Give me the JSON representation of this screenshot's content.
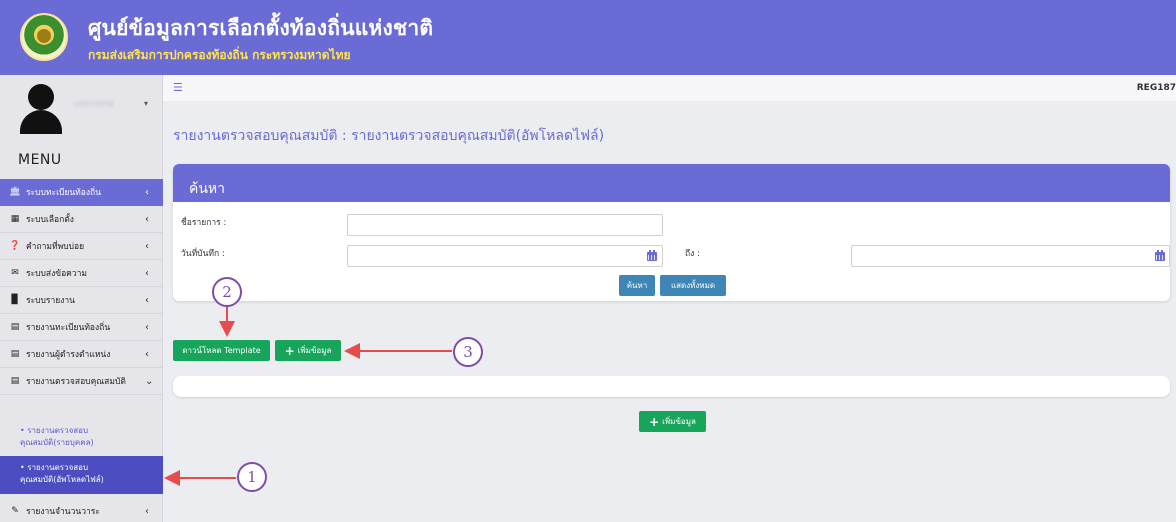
{
  "header": {
    "title": "ศูนย์ข้อมูลการเลือกตั้งท้องถิ่นแห่งชาติ",
    "subtitle": "กรมส่งเสริมการปกครองท้องถิ่น กระทรวงมหาดไทย"
  },
  "sidebar": {
    "user_name": "username",
    "menu_title": "MENU",
    "items": [
      {
        "label": "ระบบทะเบียนท้องถิ่น",
        "icon": "institution-icon"
      },
      {
        "label": "ระบบเลือกตั้ง",
        "icon": "calendar-icon"
      },
      {
        "label": "คำถามที่พบบ่อย",
        "icon": "question-icon"
      },
      {
        "label": "ระบบส่งข้อความ",
        "icon": "envelope-icon"
      },
      {
        "label": "ระบบรายงาน",
        "icon": "file-icon"
      },
      {
        "label": "รายงานทะเบียนท้องถิ่น",
        "icon": "file-text-icon"
      },
      {
        "label": "รายงานผู้ดำรงตำแหน่ง",
        "icon": "file-text-icon"
      },
      {
        "label": "รายงานตรวจสอบคุณสมบัติ",
        "icon": "file-text-icon"
      },
      {
        "label": "รายงานจำนวนวาระ",
        "icon": "edit-icon"
      }
    ],
    "sub_items": [
      {
        "label_line1": "• รายงานตรวจสอบ",
        "label_line2": "คุณสมบัติ(รายบุคคล)"
      },
      {
        "label_line1": "• รายงานตรวจสอบ",
        "label_line2": "คุณสมบัติ(อัพโหลดไฟล์)"
      }
    ]
  },
  "topstrip": {
    "menu_icon": "☰",
    "code": "REG187"
  },
  "page": {
    "title": "รายงานตรวจสอบคุณสมบัติ : รายงานตรวจสอบคุณสมบัติ(อัพโหลดไฟล์)"
  },
  "search": {
    "heading": "ค้นหา",
    "name_label": "ชื่อรายการ :",
    "name_value": "",
    "date_label": "วันที่บันทึก :",
    "date_from_value": "",
    "to_label": "ถึง :",
    "date_to_value": "",
    "search_button": "ค้นหา",
    "show_all_button": "แสดงทั้งหมด"
  },
  "actions": {
    "download_template": "ดาวน์โหลด Template",
    "add_data": "เพิ่มข้อมูล",
    "add_data_bottom": "เพิ่มข้อมูล"
  },
  "annotations": {
    "one": "1",
    "two": "2",
    "three": "3",
    "color": "#7c4ea8",
    "arrow_color": "#e84b4b"
  }
}
